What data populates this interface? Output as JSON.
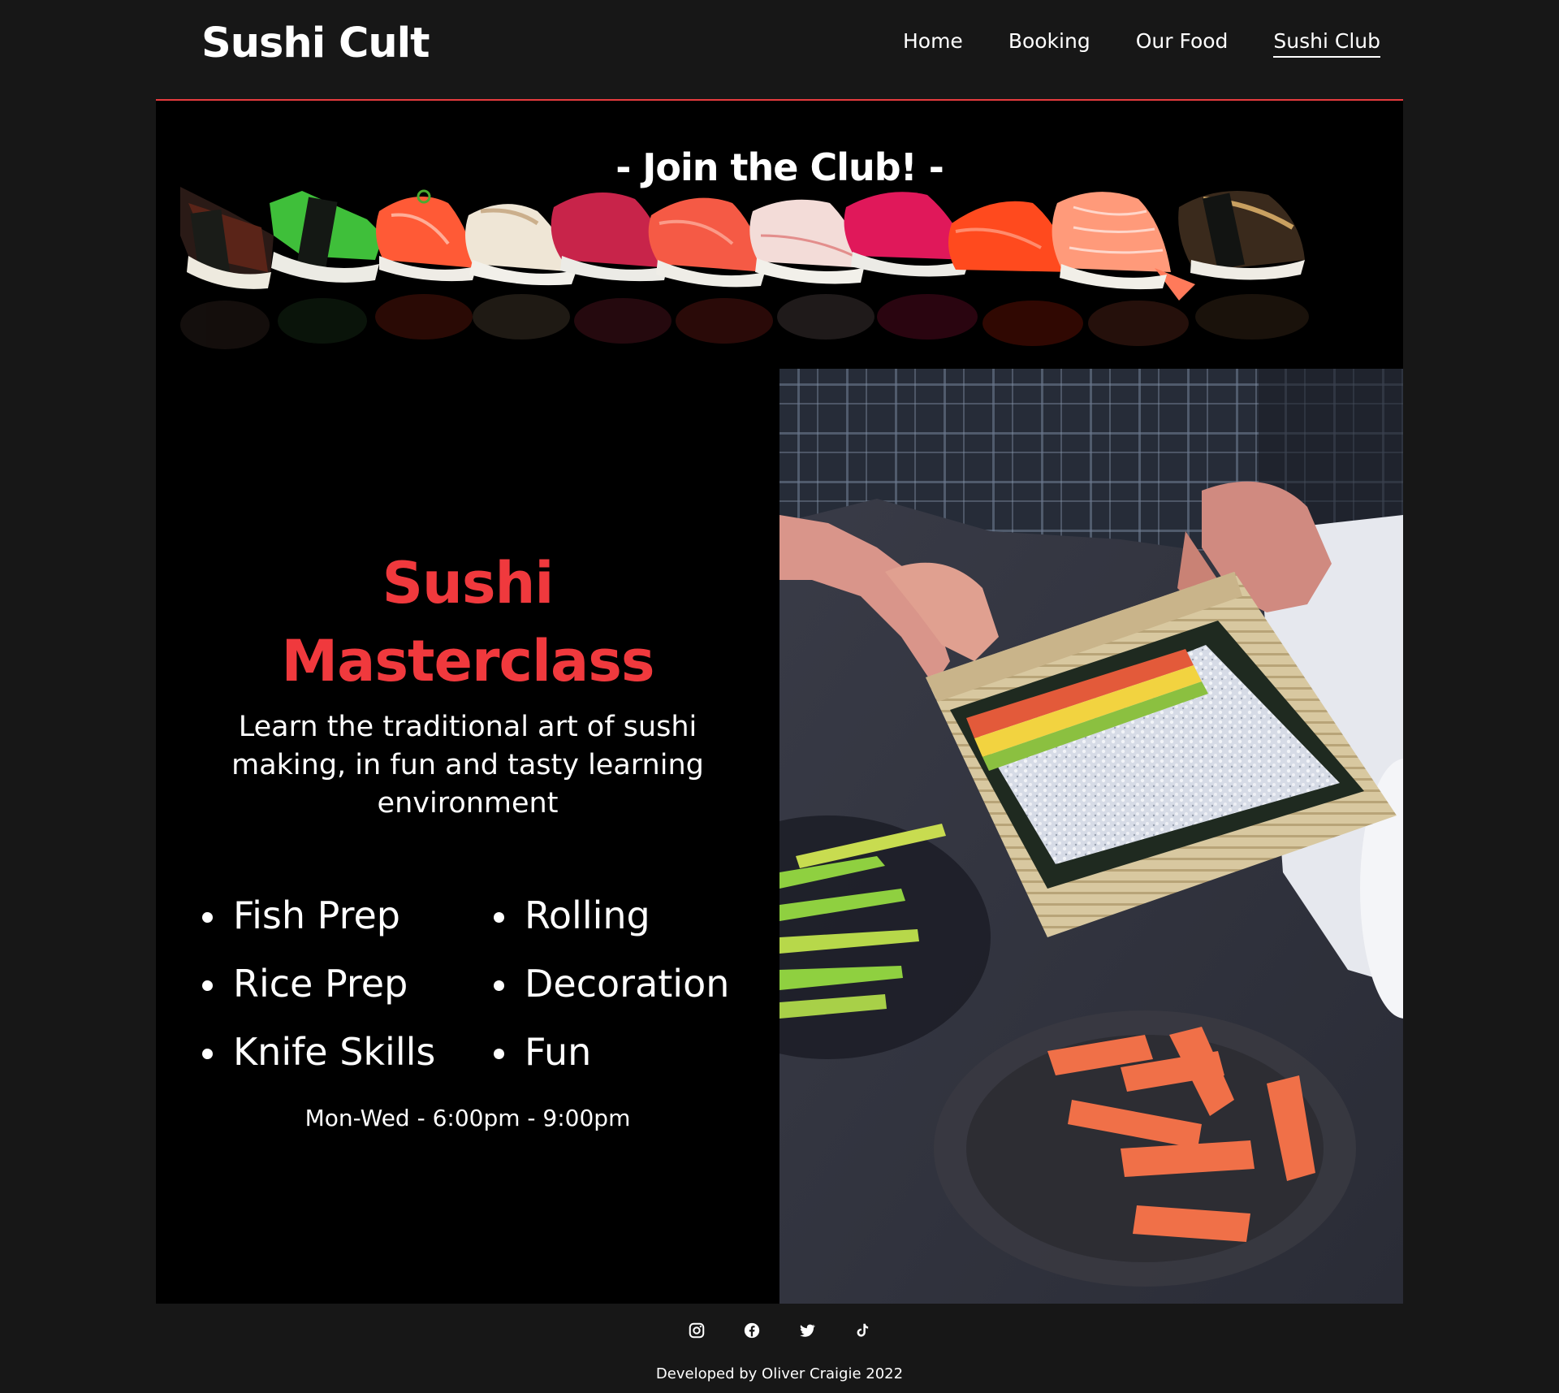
{
  "header": {
    "logo": "Sushi Cult",
    "nav": [
      {
        "label": "Home",
        "active": false
      },
      {
        "label": "Booking",
        "active": false
      },
      {
        "label": "Our Food",
        "active": false
      },
      {
        "label": "Sushi Club",
        "active": true
      }
    ]
  },
  "banner": {
    "title": "- Join the Club! -"
  },
  "masterclass": {
    "title_line1": "Sushi",
    "title_line2": "Masterclass",
    "description": "Learn the traditional art of sushi making, in fun and tasty learning environment",
    "skills_left": [
      "Fish Prep",
      "Rice Prep",
      "Knife Skills"
    ],
    "skills_right": [
      "Rolling",
      "Decoration",
      "Fun"
    ],
    "schedule": "Mon-Wed - 6:00pm - 9:00pm"
  },
  "footer": {
    "social": [
      "instagram-icon",
      "facebook-icon",
      "twitter-icon",
      "tiktok-icon"
    ],
    "credit": "Developed by Oliver Craigie 2022"
  },
  "colors": {
    "page_bg": "#171717",
    "panel_bg": "#000000",
    "accent": "#f0393d",
    "text": "#ffffff"
  }
}
